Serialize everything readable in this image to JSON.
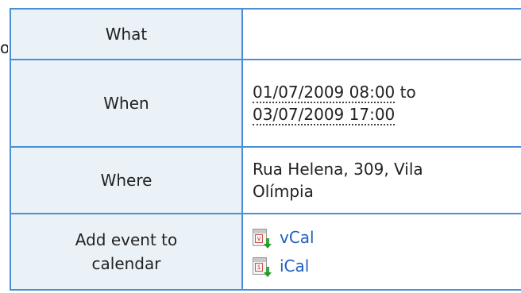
{
  "left_edge": {
    "cut_glyph": "o"
  },
  "rows": [
    {
      "label": "What",
      "value": ""
    },
    {
      "label": "When",
      "date_start": "01/07/2009 08:00",
      "connector": "to",
      "date_end": "03/07/2009 17:00"
    },
    {
      "label": "Where",
      "value_line1": "Rua Helena, 309, Vila",
      "value_line2": "Olímpia"
    },
    {
      "label_line1": "Add event to",
      "label_line2": "calendar",
      "links": [
        {
          "label": "vCal",
          "icon": "vcal-download-icon"
        },
        {
          "label": "iCal",
          "icon": "ical-download-icon"
        }
      ]
    }
  ],
  "colors": {
    "border": "#4a8ed6",
    "label_bg": "#eaf2f8",
    "link": "#1f5fbf"
  }
}
